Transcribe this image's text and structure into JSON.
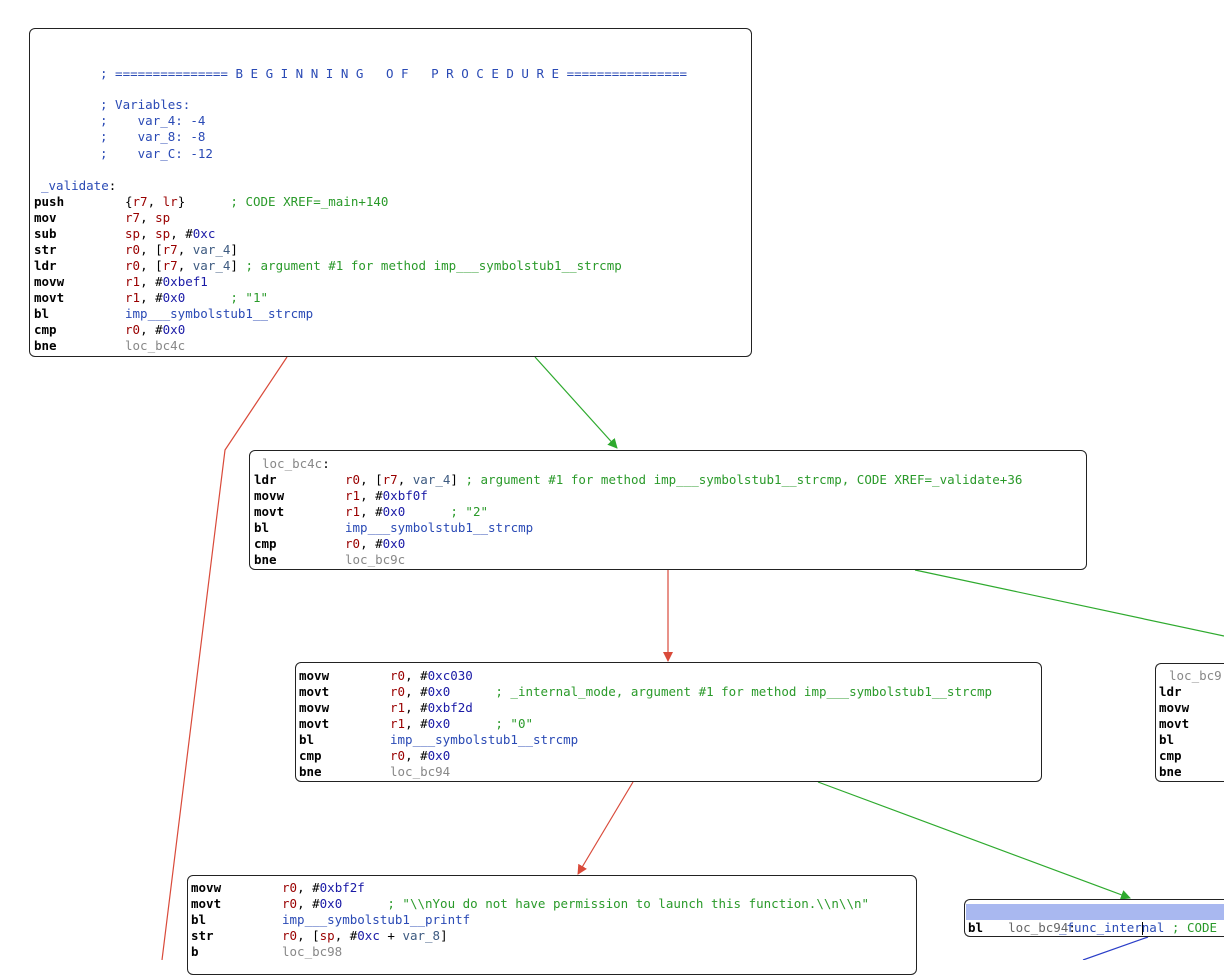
{
  "nodes": {
    "validate": {
      "banner": "; =============== B E G I N N I N G   O F   P R O C E D U R E ================",
      "vars_header": "; Variables:",
      "vars": [
        "var_4: -4",
        "var_8: -8",
        "var_C: -12"
      ],
      "label": "_validate",
      "instructions": [
        {
          "mn": "push",
          "ops": "{r7, lr}",
          "comment": "; CODE XREF=_main+140"
        },
        {
          "mn": "mov",
          "ops": "r7, sp",
          "comment": ""
        },
        {
          "mn": "sub",
          "ops": "sp, sp, #0xc",
          "comment": ""
        },
        {
          "mn": "str",
          "ops": "r0, [r7, var_4]",
          "comment": ""
        },
        {
          "mn": "ldr",
          "ops": "r0, [r7, var_4]",
          "comment": "; argument #1 for method imp___symbolstub1__strcmp"
        },
        {
          "mn": "movw",
          "ops": "r1, #0xbef1",
          "comment": ""
        },
        {
          "mn": "movt",
          "ops": "r1, #0x0",
          "comment": "; \"1\""
        },
        {
          "mn": "bl",
          "ops": "imp___symbolstub1__strcmp",
          "comment": ""
        },
        {
          "mn": "cmp",
          "ops": "r0, #0x0",
          "comment": ""
        },
        {
          "mn": "bne",
          "ops": "loc_bc4c",
          "comment": ""
        }
      ]
    },
    "loc_bc4c": {
      "label": "loc_bc4c",
      "instructions": [
        {
          "mn": "ldr",
          "ops": "r0, [r7, var_4]",
          "comment": "; argument #1 for method imp___symbolstub1__strcmp, CODE XREF=_validate+36"
        },
        {
          "mn": "movw",
          "ops": "r1, #0xbf0f",
          "comment": ""
        },
        {
          "mn": "movt",
          "ops": "r1, #0x0",
          "comment": "; \"2\""
        },
        {
          "mn": "bl",
          "ops": "imp___symbolstub1__strcmp",
          "comment": ""
        },
        {
          "mn": "cmp",
          "ops": "r0, #0x0",
          "comment": ""
        },
        {
          "mn": "bne",
          "ops": "loc_bc9c",
          "comment": ""
        }
      ]
    },
    "internal_check": {
      "instructions": [
        {
          "mn": "movw",
          "ops": "r0, #0xc030",
          "comment": ""
        },
        {
          "mn": "movt",
          "ops": "r0, #0x0",
          "comment": "; _internal_mode, argument #1 for method imp___symbolstub1__strcmp"
        },
        {
          "mn": "movw",
          "ops": "r1, #0xbf2d",
          "comment": ""
        },
        {
          "mn": "movt",
          "ops": "r1, #0x0",
          "comment": "; \"0\""
        },
        {
          "mn": "bl",
          "ops": "imp___symbolstub1__strcmp",
          "comment": ""
        },
        {
          "mn": "cmp",
          "ops": "r0, #0x0",
          "comment": ""
        },
        {
          "mn": "bne",
          "ops": "loc_bc94",
          "comment": ""
        }
      ]
    },
    "permission_denied": {
      "instructions": [
        {
          "mn": "movw",
          "ops": "r0, #0xbf2f",
          "comment": ""
        },
        {
          "mn": "movt",
          "ops": "r0, #0x0",
          "comment": "; \"\\\\nYou do not have permission to launch this function.\\\\n\\\\n\""
        },
        {
          "mn": "bl",
          "ops": "imp___symbolstub1__printf",
          "comment": ""
        },
        {
          "mn": "str",
          "ops": "r0, [sp, #0xc + var_8]",
          "comment": ""
        },
        {
          "mn": "b",
          "ops": "loc_bc98",
          "comment": ""
        }
      ]
    },
    "loc_bc9c": {
      "label": "loc_bc9",
      "mnemonics": [
        "ldr",
        "movw",
        "movt",
        "bl",
        "cmp",
        "bne"
      ]
    },
    "loc_bc94": {
      "label": "loc_bc94",
      "instructions": [
        {
          "mn": "bl",
          "ops": "_func_internal",
          "comment": "; CODE"
        }
      ]
    }
  },
  "edge_colors": {
    "taken": "#2eaa2e",
    "fallthrough": "#d94a3a",
    "unconditional": "#2a3ec8"
  }
}
